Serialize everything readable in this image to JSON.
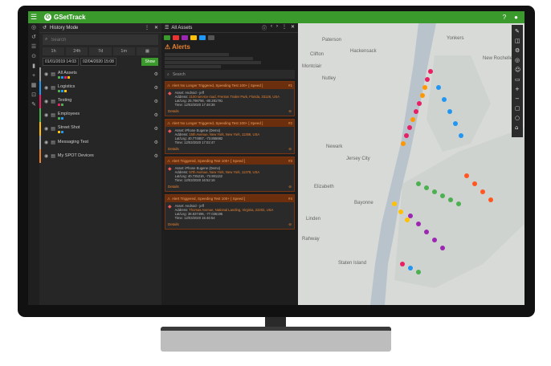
{
  "app": {
    "brand": "GSetTrack"
  },
  "history": {
    "title": "History Mode",
    "search_placeholder": "Search",
    "ranges": [
      "1h",
      "24h",
      "7d",
      "1m"
    ],
    "start": "01/01/2019 14:03",
    "end": "02/04/2020 15:08",
    "show_label": "Show",
    "groups": [
      {
        "name": "All Assets",
        "colors": [
          "#4caf50",
          "#2196f3",
          "#e91e63",
          "#ffc107"
        ],
        "edge": "#999"
      },
      {
        "name": "Logistics",
        "colors": [
          "#4caf50",
          "#2196f3",
          "#ffc107"
        ],
        "edge": "#2196f3"
      },
      {
        "name": "Testing",
        "colors": [
          "#e91e63",
          "#4caf50"
        ],
        "edge": "#e91e63"
      },
      {
        "name": "Employees",
        "colors": [
          "#4caf50",
          "#2196f3"
        ],
        "edge": "#4caf50"
      },
      {
        "name": "Street Shot",
        "colors": [
          "#ffc107",
          "#2196f3"
        ],
        "edge": "#ffc107"
      },
      {
        "name": "Messaging Test",
        "colors": [],
        "edge": "#aaa"
      },
      {
        "name": "My SPOT Devices",
        "colors": [],
        "edge": "#e88030"
      }
    ]
  },
  "alerts": {
    "header": "All Assets",
    "title": "Alerts",
    "search_placeholder": "Search",
    "items": [
      {
        "title": "Alert No Longer Triggered, Speeding Test 100+ [ Speed ]",
        "num": "#1",
        "asset": "Asset: Android - jeff",
        "address": "2100 service road, Frenton Trailer Park, Florida, 33126, USA",
        "latlng": "25.798756, -80.281791",
        "time": "12/03/2020 17:48:38",
        "details": "Details"
      },
      {
        "title": "Alert No Longer Triggered, Speeding Test 100+ [ Speed ]",
        "num": "#2",
        "asset": "Asset: iPhone Eugene (Demo)",
        "address": "15th Avenue, New York, New York, 11356, USA",
        "latlng": "40.774857, -73.855982",
        "time": "12/03/2020 17:02:47",
        "details": "Details"
      },
      {
        "title": "Alert Triggered, Speeding Test 100+ [ Speed ]",
        "num": "#3",
        "asset": "Asset: iPhone Eugene (Demo)",
        "address": "57th Avenue, New York, New York, 11378, USA",
        "latlng": "40.725216, -73.901132",
        "time": "12/03/2020 16:52:16",
        "details": "Details"
      },
      {
        "title": "Alert Triggered, Speeding Test 100+ [ Speed ]",
        "num": "#4",
        "asset": "Asset: Android - jeff",
        "address": "Thomas Avenue, National Landing, Virginia, 22202, USA",
        "latlng": "38.837496, -77.036195",
        "time": "12/03/2020 15:46:54",
        "details": "Details"
      }
    ]
  },
  "map": {
    "labels": [
      "Paterson",
      "Hackensack",
      "Yonkers",
      "Montclair",
      "Clifton",
      "Nutley",
      "New Rochelle",
      "Newark",
      "Jersey City",
      "Elizabeth",
      "Bayonne",
      "Linden",
      "Rahway",
      "Staten Island"
    ]
  }
}
